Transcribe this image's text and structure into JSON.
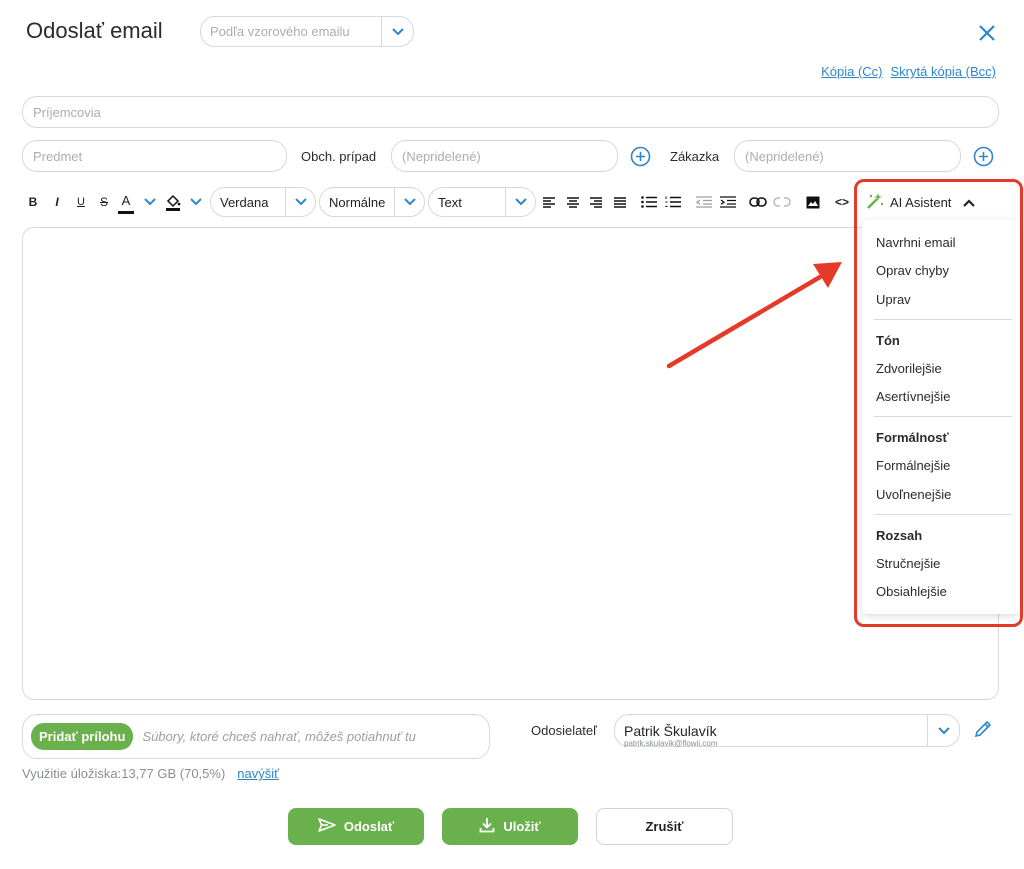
{
  "header": {
    "title": "Odoslať email",
    "template_placeholder": "Podľa vzorového emailu"
  },
  "links": {
    "cc": "Kópia (Cc)",
    "bcc": "Skrytá kópia (Bcc)"
  },
  "fields": {
    "recipients_placeholder": "Príjemcovia",
    "subject_placeholder": "Predmet",
    "case_label": "Obch. prípad",
    "case_placeholder": "(Nepridelené)",
    "order_label": "Zákazka",
    "order_placeholder": "(Nepridelené)"
  },
  "toolbar": {
    "bold": "B",
    "italic": "I",
    "underline": "U",
    "strike": "S",
    "font_color": "A",
    "font": "Verdana",
    "size": "Normálne",
    "format": "Text",
    "code": "<>"
  },
  "ai": {
    "button_label": "AI Asistent",
    "menu": {
      "suggest": "Navrhni email",
      "fix": "Oprav chyby",
      "edit": "Uprav",
      "tone_head": "Tón",
      "politer": "Zdvorilejšie",
      "assertive": "Asertívnejšie",
      "formality_head": "Formálnosť",
      "formal": "Formálnejšie",
      "relaxed": "Uvoľnenejšie",
      "scope_head": "Rozsah",
      "shorter": "Stručnejšie",
      "longer": "Obsiahlejšie"
    }
  },
  "attachments": {
    "add_button": "Pridať prílohu",
    "hint": "Súbory, ktoré chceš nahrať, môžeš potiahnuť tu",
    "storage": "Využitie úložiska:13,77 GB (70,5%)",
    "increase": "navýšiť"
  },
  "sender": {
    "label": "Odosielateľ",
    "name": "Patrik Škulavík",
    "email": "patrik.skulavik@flowii.com"
  },
  "actions": {
    "send": "Odoslať",
    "save": "Uložiť",
    "cancel": "Zrušiť"
  },
  "colors": {
    "accent_green": "#6ab04c",
    "link_blue": "#2f86c9",
    "highlight_red": "#e53a2a"
  }
}
